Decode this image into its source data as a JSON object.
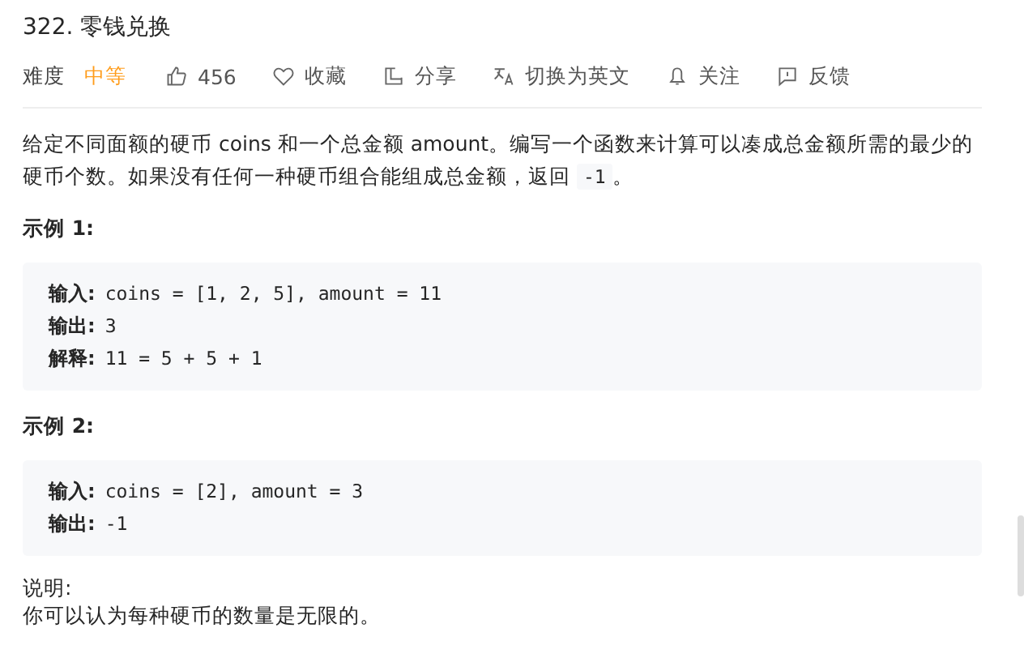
{
  "title": "322. 零钱兑换",
  "toolbar": {
    "difficulty_label": "难度",
    "difficulty": "中等",
    "actions": [
      {
        "kind": "like",
        "label": "456"
      },
      {
        "kind": "favorite",
        "label": "收藏"
      },
      {
        "kind": "share",
        "label": "分享"
      },
      {
        "kind": "translate",
        "label": "切换为英文"
      },
      {
        "kind": "follow",
        "label": "关注"
      },
      {
        "kind": "feedback",
        "label": "反馈"
      }
    ]
  },
  "description": {
    "text": "给定不同面额的硬币 coins 和一个总金额 amount。编写一个函数来计算可以凑成总金额所需的最少的硬币个数。如果没有任何一种硬币组合能组成总金额，返回 ",
    "code": "-1",
    "end": "。"
  },
  "examples": [
    {
      "heading": "示例 1:",
      "lines": [
        {
          "label": "输入:",
          "value": "coins = [1, 2, 5], amount = 11"
        },
        {
          "label": "输出:",
          "value": "3"
        },
        {
          "label": "解释:",
          "value": "11 = 5 + 5 + 1"
        }
      ]
    },
    {
      "heading": "示例 2:",
      "lines": [
        {
          "label": "输入:",
          "value": "coins = [2], amount = 3"
        },
        {
          "label": "输出:",
          "value": "-1"
        }
      ]
    }
  ],
  "note": {
    "heading": "说明:",
    "text": "你可以认为每种硬币的数量是无限的。"
  }
}
